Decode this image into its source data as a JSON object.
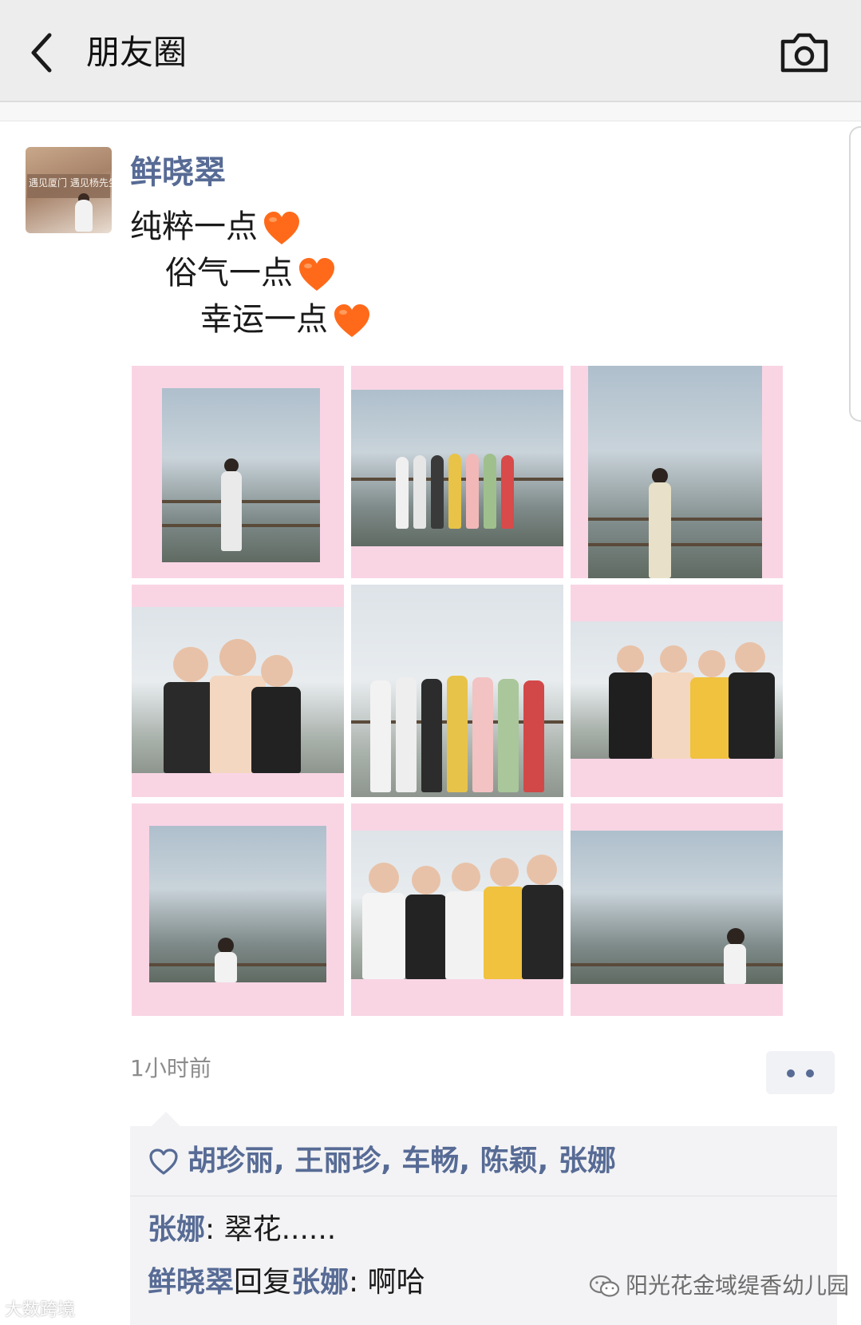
{
  "header": {
    "title": "朋友圈",
    "back_icon": "chevron-left-icon",
    "camera_icon": "camera-icon"
  },
  "post": {
    "username": "鲜晓翠",
    "text_lines": [
      "纯粹一点",
      "俗气一点",
      "幸运一点"
    ],
    "heart_color": "#ff6a1a",
    "avatar_sign_text": "遇见厦门 遇见杨先生",
    "photo_count": 9,
    "time": "1小时前",
    "more_icon": "more-dots-icon"
  },
  "social": {
    "like_icon": "heart-outline-icon",
    "likers": "胡珍丽, 王丽珍, 车畅, 陈颖, 张娜",
    "comments": [
      {
        "author": "张娜",
        "separator": ": ",
        "text": "翠花......"
      },
      {
        "author": "鲜晓翠",
        "reply_word": "回复",
        "reply_to": "张娜",
        "separator": ": ",
        "text": "啊哈"
      }
    ]
  },
  "watermarks": {
    "left": "大数跨境",
    "right": "阳光花金域缇香幼儿园"
  },
  "colors": {
    "link": "#576b95",
    "topbar": "#ededed",
    "photo_frame": "#f9d5e4"
  }
}
